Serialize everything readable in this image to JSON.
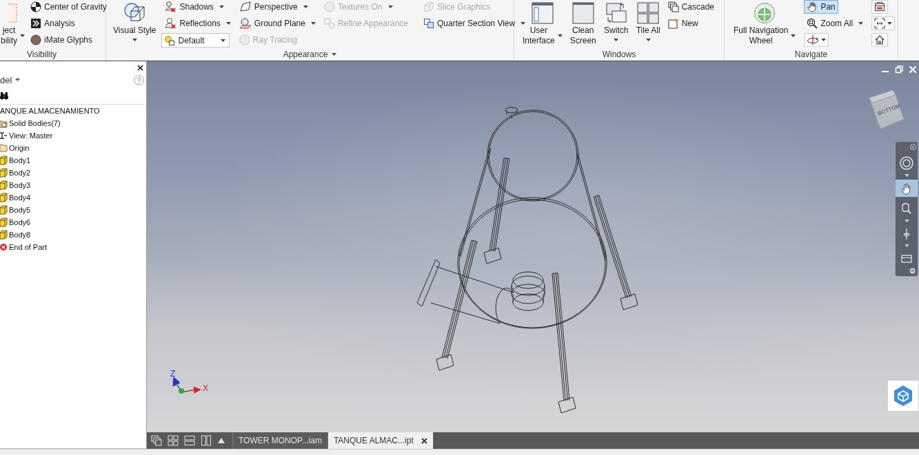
{
  "ribbon": {
    "panels": [
      {
        "title": "Visibility",
        "menu": false,
        "groups": [
          {
            "kind": "large",
            "lines": [
              "ject",
              "bility"
            ],
            "dropdown": true
          },
          {
            "kind": "stack",
            "items": [
              {
                "kind": "button",
                "label": "Center of Gravity",
                "dropdown": false,
                "disabled": false
              },
              {
                "kind": "button",
                "label": "Analysis",
                "dropdown": false,
                "disabled": false
              },
              {
                "kind": "button",
                "label": "iMate Glyphs",
                "dropdown": false,
                "disabled": false
              }
            ]
          }
        ]
      },
      {
        "title": "Appearance",
        "menu": true,
        "groups": [
          {
            "kind": "large",
            "lines": [
              "Visual Style"
            ],
            "dropdown": true
          },
          {
            "kind": "stack",
            "items": [
              {
                "kind": "button",
                "label": "Shadows",
                "dropdown": true,
                "disabled": false
              },
              {
                "kind": "button",
                "label": "Reflections",
                "dropdown": true,
                "disabled": false
              },
              {
                "kind": "combo",
                "value": "Default"
              }
            ]
          },
          {
            "kind": "stack",
            "items": [
              {
                "kind": "button",
                "label": "Perspective",
                "dropdown": true,
                "disabled": false
              },
              {
                "kind": "button",
                "label": "Ground Plane",
                "dropdown": true,
                "disabled": false
              },
              {
                "kind": "button",
                "label": "Ray Tracing",
                "dropdown": false,
                "disabled": true
              }
            ]
          },
          {
            "kind": "stack",
            "items": [
              {
                "kind": "button",
                "label": "Textures On",
                "dropdown": true,
                "disabled": true
              },
              {
                "kind": "button",
                "label": "Refine Appearance",
                "dropdown": false,
                "disabled": true
              }
            ]
          },
          {
            "kind": "separator"
          },
          {
            "kind": "stack",
            "items": [
              {
                "kind": "button",
                "label": "Slice Graphics",
                "dropdown": false,
                "disabled": true
              },
              {
                "kind": "button",
                "label": "Quarter Section View",
                "dropdown": true,
                "disabled": false
              }
            ]
          }
        ]
      },
      {
        "title": "Windows",
        "menu": false,
        "groups": [
          {
            "kind": "large",
            "lines": [
              "User",
              "Interface"
            ],
            "dropdown": true
          },
          {
            "kind": "large",
            "lines": [
              "Clean",
              "Screen"
            ],
            "dropdown": false
          },
          {
            "kind": "large",
            "lines": [
              "Switch"
            ],
            "dropdown": true
          },
          {
            "kind": "large",
            "lines": [
              "Tile All"
            ],
            "dropdown": true
          },
          {
            "kind": "stack",
            "items": [
              {
                "kind": "button",
                "label": "Cascade",
                "dropdown": false,
                "disabled": false
              },
              {
                "kind": "button",
                "label": "New",
                "dropdown": false,
                "disabled": false
              }
            ]
          }
        ]
      },
      {
        "title": "Navigate",
        "menu": false,
        "groups": [
          {
            "kind": "large",
            "lines": [
              "Full Navigation",
              "Wheel"
            ],
            "dropdown": true
          },
          {
            "kind": "stack",
            "items": [
              {
                "kind": "button",
                "label": "Pan",
                "dropdown": false,
                "disabled": false,
                "selected": true
              },
              {
                "kind": "button",
                "label": "Zoom All",
                "dropdown": true,
                "disabled": false,
                "selected": false
              },
              {
                "kind": "icon",
                "dropdown": true,
                "selected": false
              }
            ]
          },
          {
            "kind": "stack",
            "items": [
              {
                "kind": "icon",
                "dropdown": false,
                "selected": false
              },
              {
                "kind": "icon",
                "dropdown": true,
                "selected": false
              },
              {
                "kind": "icon",
                "dropdown": false,
                "selected": false
              }
            ]
          }
        ]
      }
    ]
  },
  "browser": {
    "title": "del",
    "tree": [
      {
        "label": "ANQUE ALMACENAMIENTO",
        "children": [
          {
            "kind": "bodies",
            "label": "Solid Bodies(7)"
          },
          {
            "kind": "view",
            "label": "View: Master"
          },
          {
            "kind": "folder",
            "label": "Origin"
          },
          {
            "kind": "body",
            "label": "Body1"
          },
          {
            "kind": "body",
            "label": "Body2"
          },
          {
            "kind": "body",
            "label": "Body3"
          },
          {
            "kind": "body",
            "label": "Body4"
          },
          {
            "kind": "body",
            "label": "Body5"
          },
          {
            "kind": "body",
            "label": "Body6"
          },
          {
            "kind": "body",
            "label": "Body8"
          },
          {
            "kind": "end",
            "label": "End of Part"
          }
        ]
      }
    ]
  },
  "viewport": {
    "view_cube": {
      "face": "BOTTOM"
    },
    "triad": [
      {
        "label": "Z",
        "color": "#2433c8"
      },
      {
        "label": "X",
        "color": "#d12a2a"
      }
    ]
  },
  "navigation_bar": {
    "tools": [
      {
        "dropdown": true,
        "selected": false
      },
      {
        "dropdown": false,
        "selected": true
      },
      {
        "dropdown": true,
        "selected": false
      },
      {
        "dropdown": true,
        "selected": false
      },
      {
        "dropdown": false,
        "selected": false
      }
    ]
  },
  "document_tabs": [
    {
      "label": "TOWER MONOP...iam",
      "selected": false
    },
    {
      "label": "TANQUE ALMAC...ipt",
      "selected": true
    }
  ]
}
